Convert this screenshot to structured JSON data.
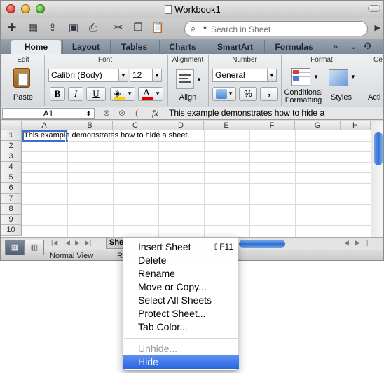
{
  "window": {
    "title": "Workbook1"
  },
  "toolbar": {
    "icons": [
      "new-icon",
      "templates-icon",
      "open-icon",
      "save-icon",
      "print-icon",
      "cut-icon",
      "copy-icon",
      "paste-icon"
    ],
    "search_placeholder": "Search in Sheet"
  },
  "tabs": [
    {
      "label": "Home",
      "active": true
    },
    {
      "label": "Layout"
    },
    {
      "label": "Tables"
    },
    {
      "label": "Charts"
    },
    {
      "label": "SmartArt"
    },
    {
      "label": "Formulas"
    }
  ],
  "ribbon": {
    "edit": {
      "title": "Edit",
      "paste_label": "Paste"
    },
    "font": {
      "title": "Font",
      "family": "Calibri (Body)",
      "size": "12",
      "bold": "B",
      "italic": "I",
      "underline": "U",
      "font_color_glyph": "A",
      "fill_color": "#ffd200",
      "font_color": "#e00000"
    },
    "alignment": {
      "title": "Alignment",
      "align_label": "Align"
    },
    "number": {
      "title": "Number",
      "format": "General",
      "percent": "%",
      "comma": ","
    },
    "format": {
      "title": "Format",
      "conditional_label_1": "Conditional",
      "conditional_label_2": "Formatting",
      "styles_label": "Styles"
    },
    "cells": {
      "title": "Ce",
      "actions_label": "Acti"
    }
  },
  "formula_bar": {
    "name_box": "A1",
    "fx": "fx",
    "content": "This example demonstrates how to hide a"
  },
  "grid": {
    "columns": [
      "A",
      "B",
      "C",
      "D",
      "E",
      "F",
      "G",
      "H"
    ],
    "rows": [
      "1",
      "2",
      "3",
      "4",
      "5",
      "6",
      "7",
      "8",
      "9",
      "10"
    ],
    "a1_text": "This example demonstrates how to hide a sheet."
  },
  "sheet_tab": {
    "label": "Shee"
  },
  "status": {
    "view": "Normal View",
    "ready": "Re"
  },
  "context_menu": {
    "items": [
      {
        "label": "Insert Sheet",
        "shortcut": "⇧F11"
      },
      {
        "label": "Delete"
      },
      {
        "label": "Rename"
      },
      {
        "label": "Move or Copy..."
      },
      {
        "label": "Select All Sheets"
      },
      {
        "label": "Protect Sheet..."
      },
      {
        "label": "Tab Color..."
      },
      {
        "label": "Unhide...",
        "disabled": true
      },
      {
        "label": "Hide",
        "highlighted": true
      }
    ]
  },
  "colors": {
    "selection": "#3d6ec9",
    "menu_highlight": "#2c64dd"
  }
}
